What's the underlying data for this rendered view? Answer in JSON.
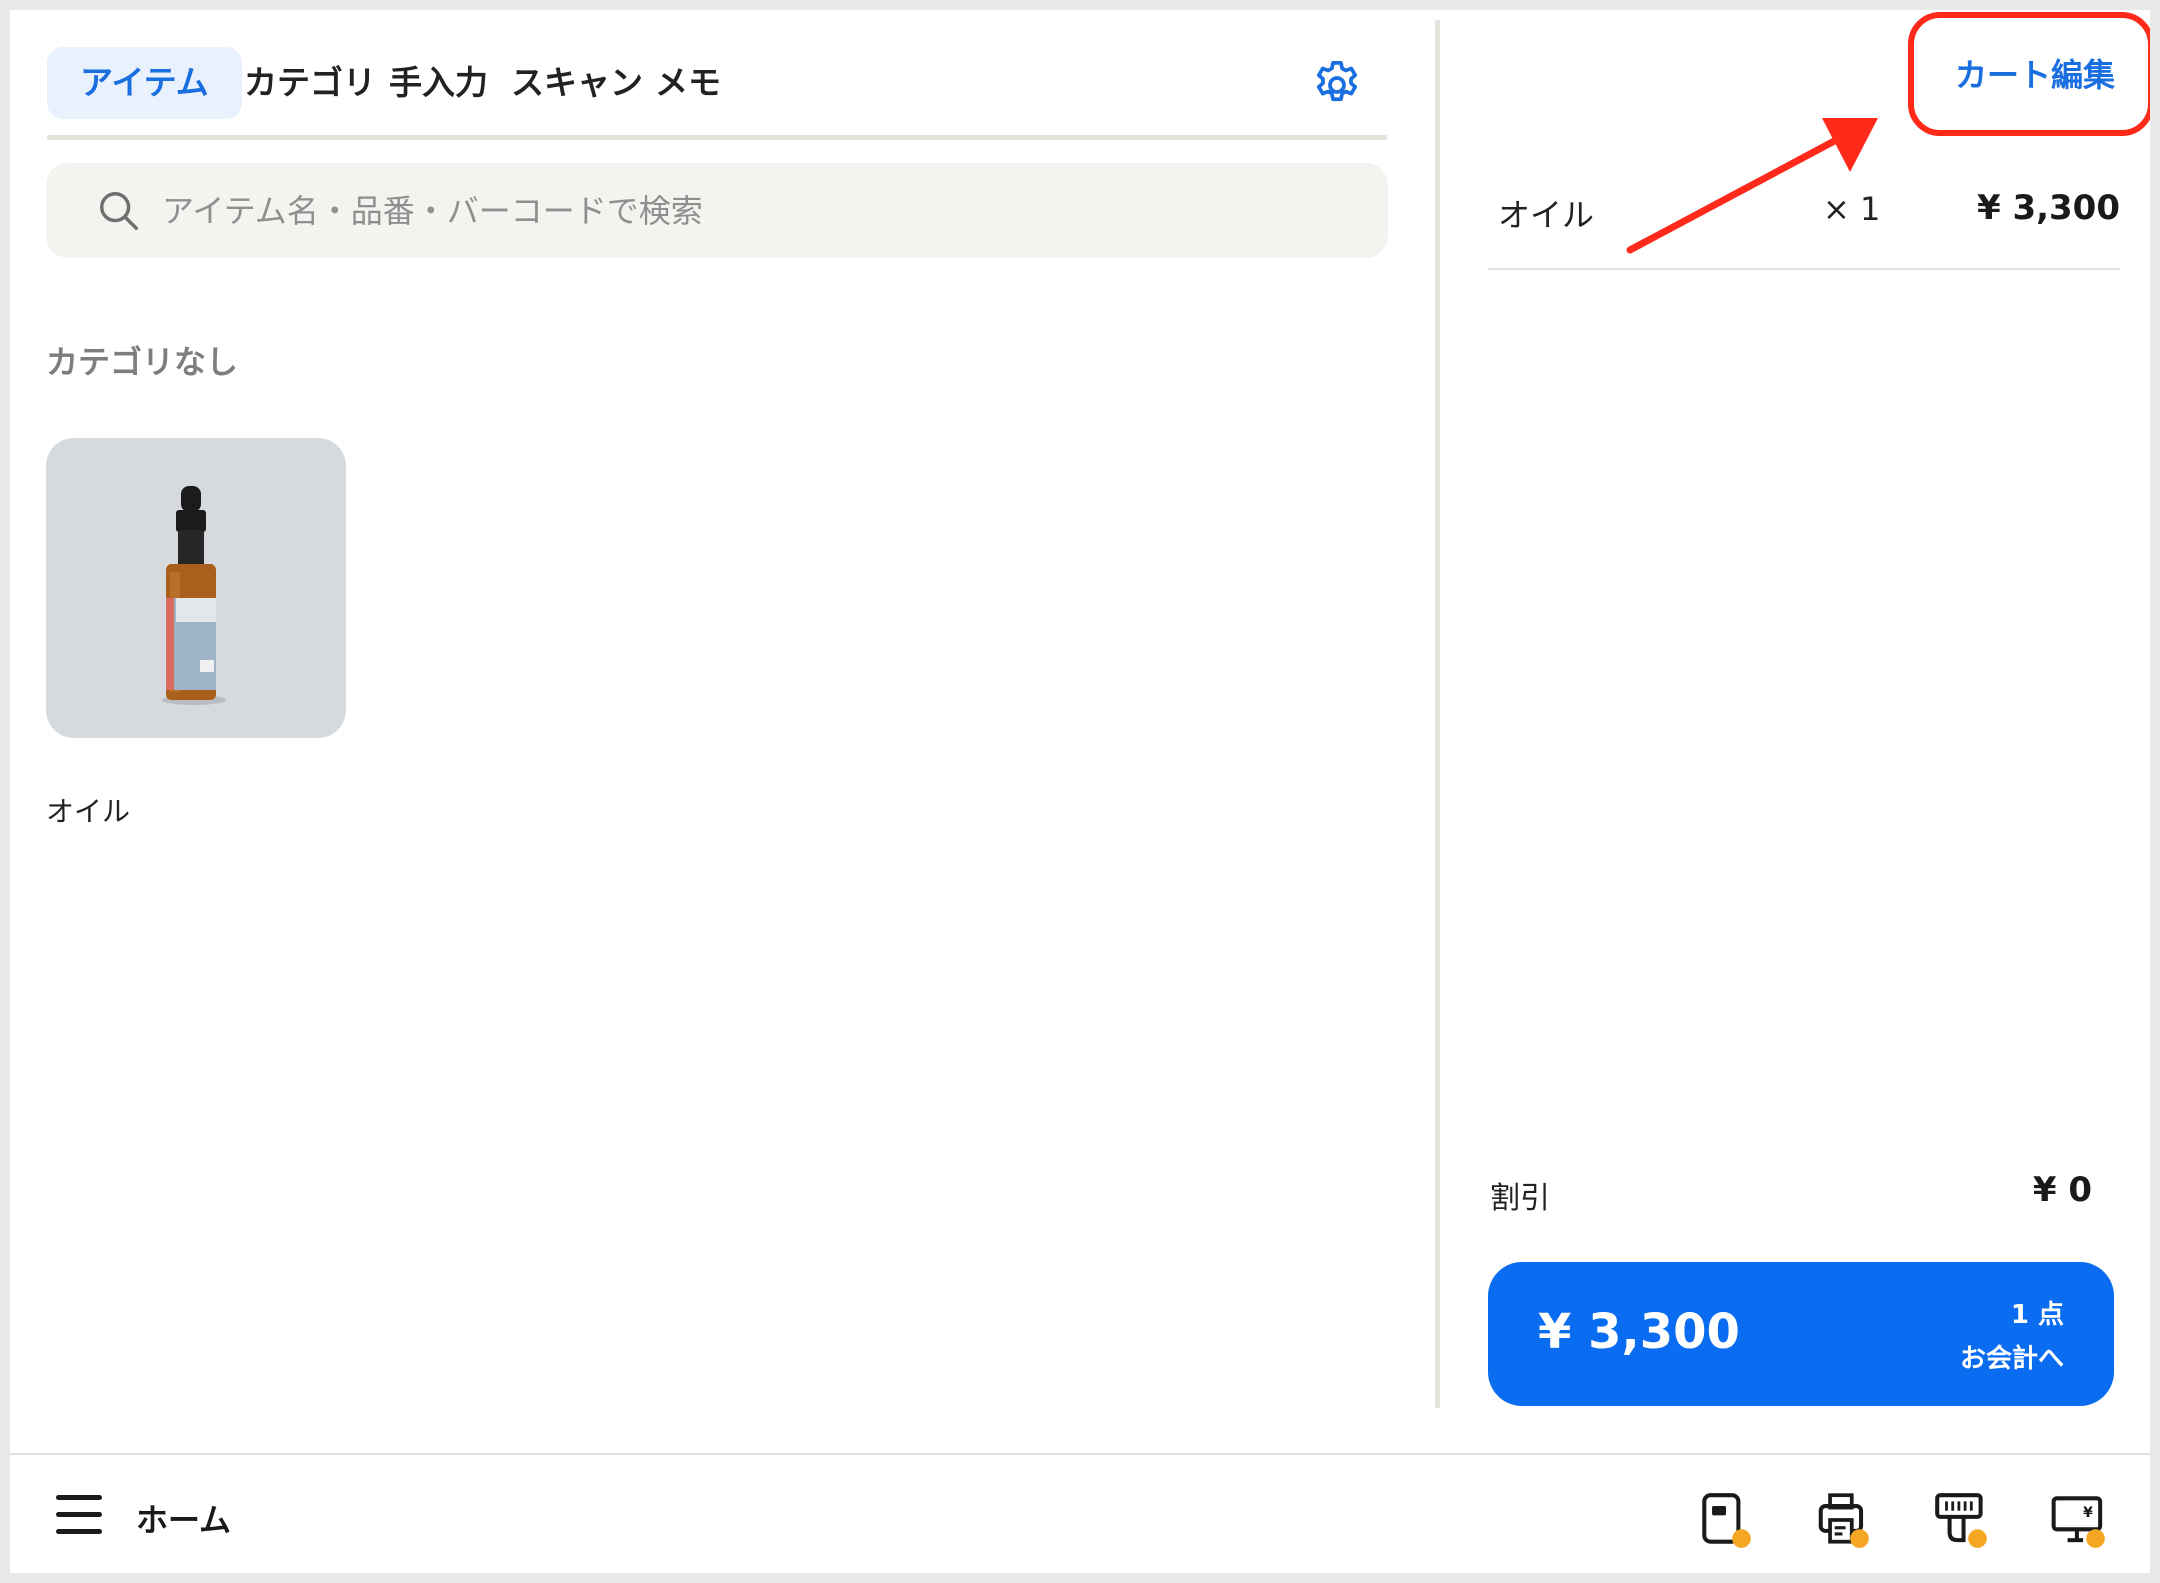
{
  "tabs": [
    {
      "label": "アイテム",
      "active": true
    },
    {
      "label": "カテゴリ",
      "active": false
    },
    {
      "label": "手入力",
      "active": false
    },
    {
      "label": "スキャン",
      "active": false
    },
    {
      "label": "メモ",
      "active": false
    }
  ],
  "search": {
    "placeholder": "アイテム名・品番・バーコードで検索"
  },
  "category": {
    "heading": "カテゴリなし",
    "items": [
      {
        "name": "オイル"
      }
    ]
  },
  "cart": {
    "edit_label": "カート編集",
    "items": [
      {
        "name": "オイル",
        "qty": "× 1",
        "price": "¥ 3,300"
      }
    ],
    "discount_label": "割引",
    "discount_value": "¥ 0",
    "total": "¥ 3,300",
    "count": "1 点",
    "checkout_label": "お会計へ"
  },
  "bottom": {
    "home_label": "ホーム"
  },
  "icons": {
    "settings": "gear-icon",
    "search": "search-icon",
    "menu": "hamburger-menu-icon",
    "devices": [
      "card-reader-icon",
      "receipt-printer-icon",
      "barcode-scanner-icon",
      "customer-display-icon"
    ]
  },
  "colors": {
    "accent": "#0a6cf0",
    "accent_text": "#1a6fe0",
    "callout": "#ff2a1a",
    "status_dot": "#f5a623"
  }
}
